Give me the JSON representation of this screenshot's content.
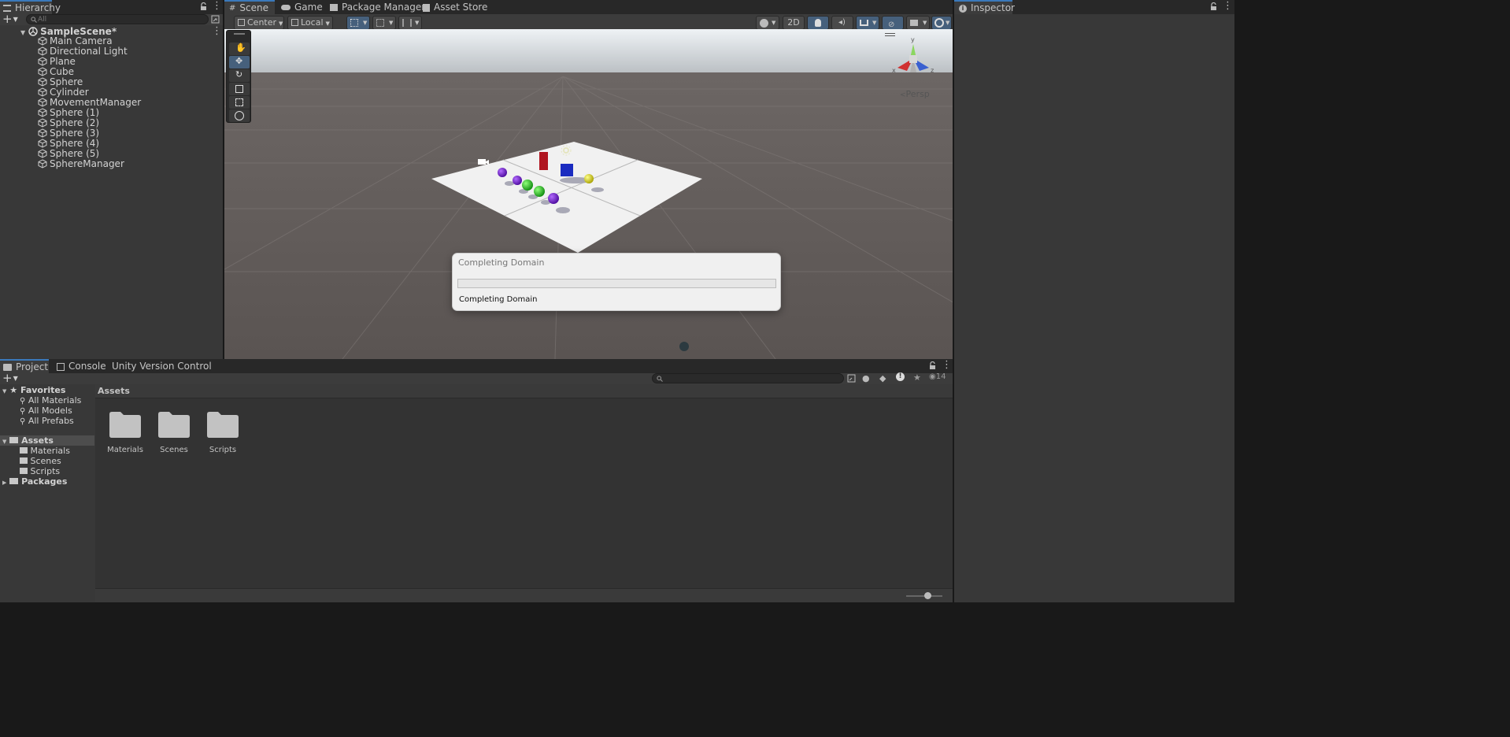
{
  "hierarchy": {
    "tab_label": "Hierarchy",
    "search_placeholder": "All",
    "scene_name": "SampleScene*",
    "items": [
      "Main Camera",
      "Directional Light",
      "Plane",
      "Cube",
      "Sphere",
      "Cylinder",
      "MovementManager",
      "Sphere (1)",
      "Sphere (2)",
      "Sphere (3)",
      "Sphere (4)",
      "Sphere (5)",
      "SphereManager"
    ]
  },
  "scene_tabs": {
    "scene": "Scene",
    "game": "Game",
    "package_manager": "Package Manager",
    "asset_store": "Asset Store"
  },
  "scene_toolbar": {
    "pivot": "Center",
    "space": "Local",
    "mode_2d": "2D"
  },
  "gizmo": {
    "projection": "Persp",
    "axis_y": "y",
    "axis_x": "x",
    "axis_z": "z"
  },
  "progress_dialog": {
    "title": "Completing Domain",
    "message": "Completing Domain",
    "progress": 0
  },
  "inspector": {
    "tab_label": "Inspector"
  },
  "bottom_tabs": {
    "project": "Project",
    "console": "Console",
    "version_control": "Unity Version Control"
  },
  "project": {
    "hidden_count": "14",
    "favorites_label": "Favorites",
    "favorites": [
      "All Materials",
      "All Models",
      "All Prefabs"
    ],
    "assets_label": "Assets",
    "asset_folders": [
      "Materials",
      "Scenes",
      "Scripts"
    ],
    "packages_label": "Packages",
    "breadcrumb": "Assets",
    "grid_items": [
      "Materials",
      "Scenes",
      "Scripts"
    ]
  },
  "colors": {
    "accent": "#3a79bb",
    "panel": "#383838",
    "tabbar": "#282828",
    "scene_sky": "#dfe6ec",
    "scene_ground": "#625c5a"
  }
}
